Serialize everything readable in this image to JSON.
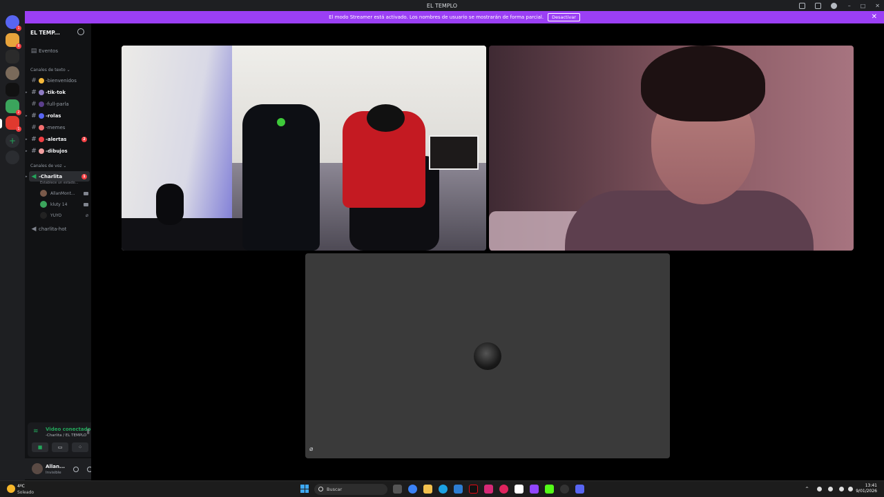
{
  "window": {
    "title": "EL TEMPLO",
    "controls": [
      "–",
      "□",
      "✕"
    ]
  },
  "banner": {
    "text": "El modo Streamer está activado. Los nombres de usuario se mostrarán de forma parcial.",
    "button": "Desactivar",
    "close": "✕"
  },
  "sidebar": {
    "guild_name": "EL TEMP...",
    "events": "Eventos",
    "text_category": "Canales de texto",
    "text_channels": [
      {
        "name": "-bienvenidos",
        "emoji_color": "#f6b93b"
      },
      {
        "name": "-tik-tok",
        "emoji_color": "#8e7cc3"
      },
      {
        "name": "-full-parla",
        "emoji_color": "#5b3f8c"
      },
      {
        "name": "-rolas",
        "emoji_color": "#5865f2"
      },
      {
        "name": "-memes",
        "emoji_color": "#f26f6f"
      },
      {
        "name": "-alertas",
        "emoji_color": "#f23f43",
        "mention": "2"
      },
      {
        "name": "-dibujos",
        "emoji_color": "#f2a0a0"
      }
    ],
    "voice_category": "Canales de voz",
    "voice_channel": {
      "name": "-Charlita",
      "mention": "1",
      "status": "Establece un estado..."
    },
    "voice_users": [
      {
        "name": "AllanMont...",
        "avatar_color": "#7a5a4a"
      },
      {
        "name": "kluty 14",
        "avatar_color": "#3ba55c"
      },
      {
        "name": "YUYO",
        "avatar_color": "#222222"
      }
    ],
    "other_voice": "charlita-hot"
  },
  "voice_panel": {
    "title": "Video conectado",
    "sub": "-Charlita / EL TEMPLO"
  },
  "user_panel": {
    "name": "Allan...",
    "status": "Invisible"
  },
  "taskbar": {
    "temp": "4ºC",
    "weather": "Soleado",
    "search": "Buscar",
    "time": "13:41",
    "date": "9/01/2026"
  },
  "colors": {
    "banner": "#9b3ff5",
    "connected": "#23a55a",
    "mention": "#f23f43"
  }
}
